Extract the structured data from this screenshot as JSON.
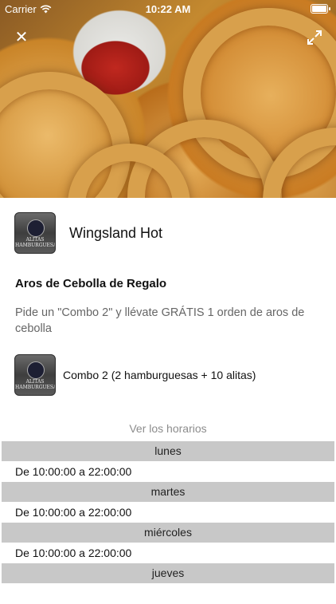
{
  "status_bar": {
    "carrier": "Carrier",
    "time": "10:22 AM"
  },
  "icons": {
    "close": "close-icon",
    "expand": "expand-icon",
    "wifi": "wifi-icon",
    "battery": "battery-icon"
  },
  "business": {
    "name": "Wingsland Hot",
    "logo_text_line1": "ALITAS",
    "logo_text_line2": "HAMBURGUESAS"
  },
  "offer": {
    "title": "Aros de Cebolla de Regalo",
    "description": "Pide un \"Combo 2\" y llévate GRÁTIS 1 orden de aros de cebolla",
    "item_label": "Combo 2 (2 hamburguesas + 10 alitas)"
  },
  "hours": {
    "link_label": "Ver los horarios",
    "days": [
      {
        "day": "lunes",
        "time": "De 10:00:00  a 22:00:00"
      },
      {
        "day": "martes",
        "time": "De 10:00:00  a 22:00:00"
      },
      {
        "day": "miércoles",
        "time": "De 10:00:00  a 22:00:00"
      },
      {
        "day": "jueves",
        "time": ""
      }
    ]
  },
  "colors": {
    "day_header_bg": "#c8c8c8",
    "muted_text": "#8c8c8c"
  }
}
